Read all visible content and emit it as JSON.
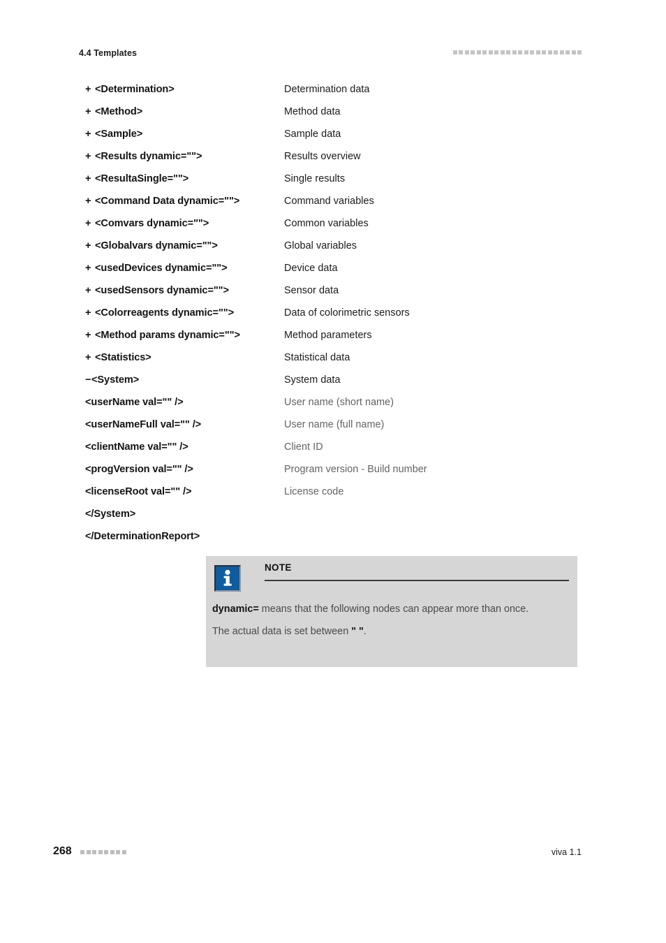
{
  "header": {
    "section": "4.4 Templates",
    "decor_square_count": 22,
    "decor_color": "#c4c4c4"
  },
  "nodes": [
    {
      "sign": "+",
      "tag": "<Determination>",
      "desc": "Determination data",
      "muted": false
    },
    {
      "sign": "+",
      "tag": "<Method>",
      "desc": "Method data",
      "muted": false
    },
    {
      "sign": "+",
      "tag": "<Sample>",
      "desc": "Sample data",
      "muted": false
    },
    {
      "sign": "+",
      "tag": "<Results dynamic=\"\">",
      "desc": "Results overview",
      "muted": false
    },
    {
      "sign": "+",
      "tag": "<ResultaSingle=\"\">",
      "desc": "Single results",
      "muted": false
    },
    {
      "sign": "+",
      "tag": "<Command Data dynamic=\"\">",
      "desc": "Command variables",
      "muted": false
    },
    {
      "sign": "+",
      "tag": "<Comvars dynamic=\"\">",
      "desc": "Common variables",
      "muted": false
    },
    {
      "sign": "+",
      "tag": "<Globalvars dynamic=\"\">",
      "desc": "Global variables",
      "muted": false
    },
    {
      "sign": "+",
      "tag": "<usedDevices dynamic=\"\">",
      "desc": "Device data",
      "muted": false
    },
    {
      "sign": "+",
      "tag": "<usedSensors dynamic=\"\">",
      "desc": "Sensor data",
      "muted": false
    },
    {
      "sign": "+",
      "tag": "<Colorreagents dynamic=\"\">",
      "desc": "Data of colorimetric sensors",
      "muted": false
    },
    {
      "sign": "+",
      "tag": "<Method params dynamic=\"\">",
      "desc": "Method parameters",
      "muted": false
    },
    {
      "sign": "+",
      "tag": "<Statistics>",
      "desc": "Statistical data",
      "muted": false
    },
    {
      "sign": "−",
      "tag": "<System>",
      "desc": "System data",
      "muted": false
    },
    {
      "sign": "",
      "tag": "<userName val=\"\" />",
      "desc": "User name (short name)",
      "muted": true
    },
    {
      "sign": "",
      "tag": "<userNameFull val=\"\" />",
      "desc": "User name (full name)",
      "muted": true
    },
    {
      "sign": "",
      "tag": "<clientName val=\"\" />",
      "desc": "Client ID",
      "muted": true
    },
    {
      "sign": "",
      "tag": "<progVersion val=\"\" />",
      "desc": "Program version - Build number",
      "muted": true
    },
    {
      "sign": "",
      "tag": "<licenseRoot val=\"\" />",
      "desc": "License code",
      "muted": true
    },
    {
      "sign": "",
      "tag": "</System>",
      "desc": "",
      "muted": false
    },
    {
      "sign": "",
      "tag": "</DeterminationReport>",
      "desc": "",
      "muted": false
    }
  ],
  "note": {
    "title": "NOTE",
    "icon": "info-icon",
    "icon_color": "#0f5c9e",
    "background_color": "#d6d6d6",
    "paragraph_1_bold": "dynamic=",
    "paragraph_1_rest": " means that the following nodes can appear more than once.",
    "paragraph_2_before": "The actual data is set between ",
    "paragraph_2_quotes": "\" \"",
    "paragraph_2_after": "."
  },
  "footer": {
    "page_number": "268",
    "decor_square_count": 8,
    "decor_color": "#bdbdbd",
    "product": "viva 1.1"
  }
}
